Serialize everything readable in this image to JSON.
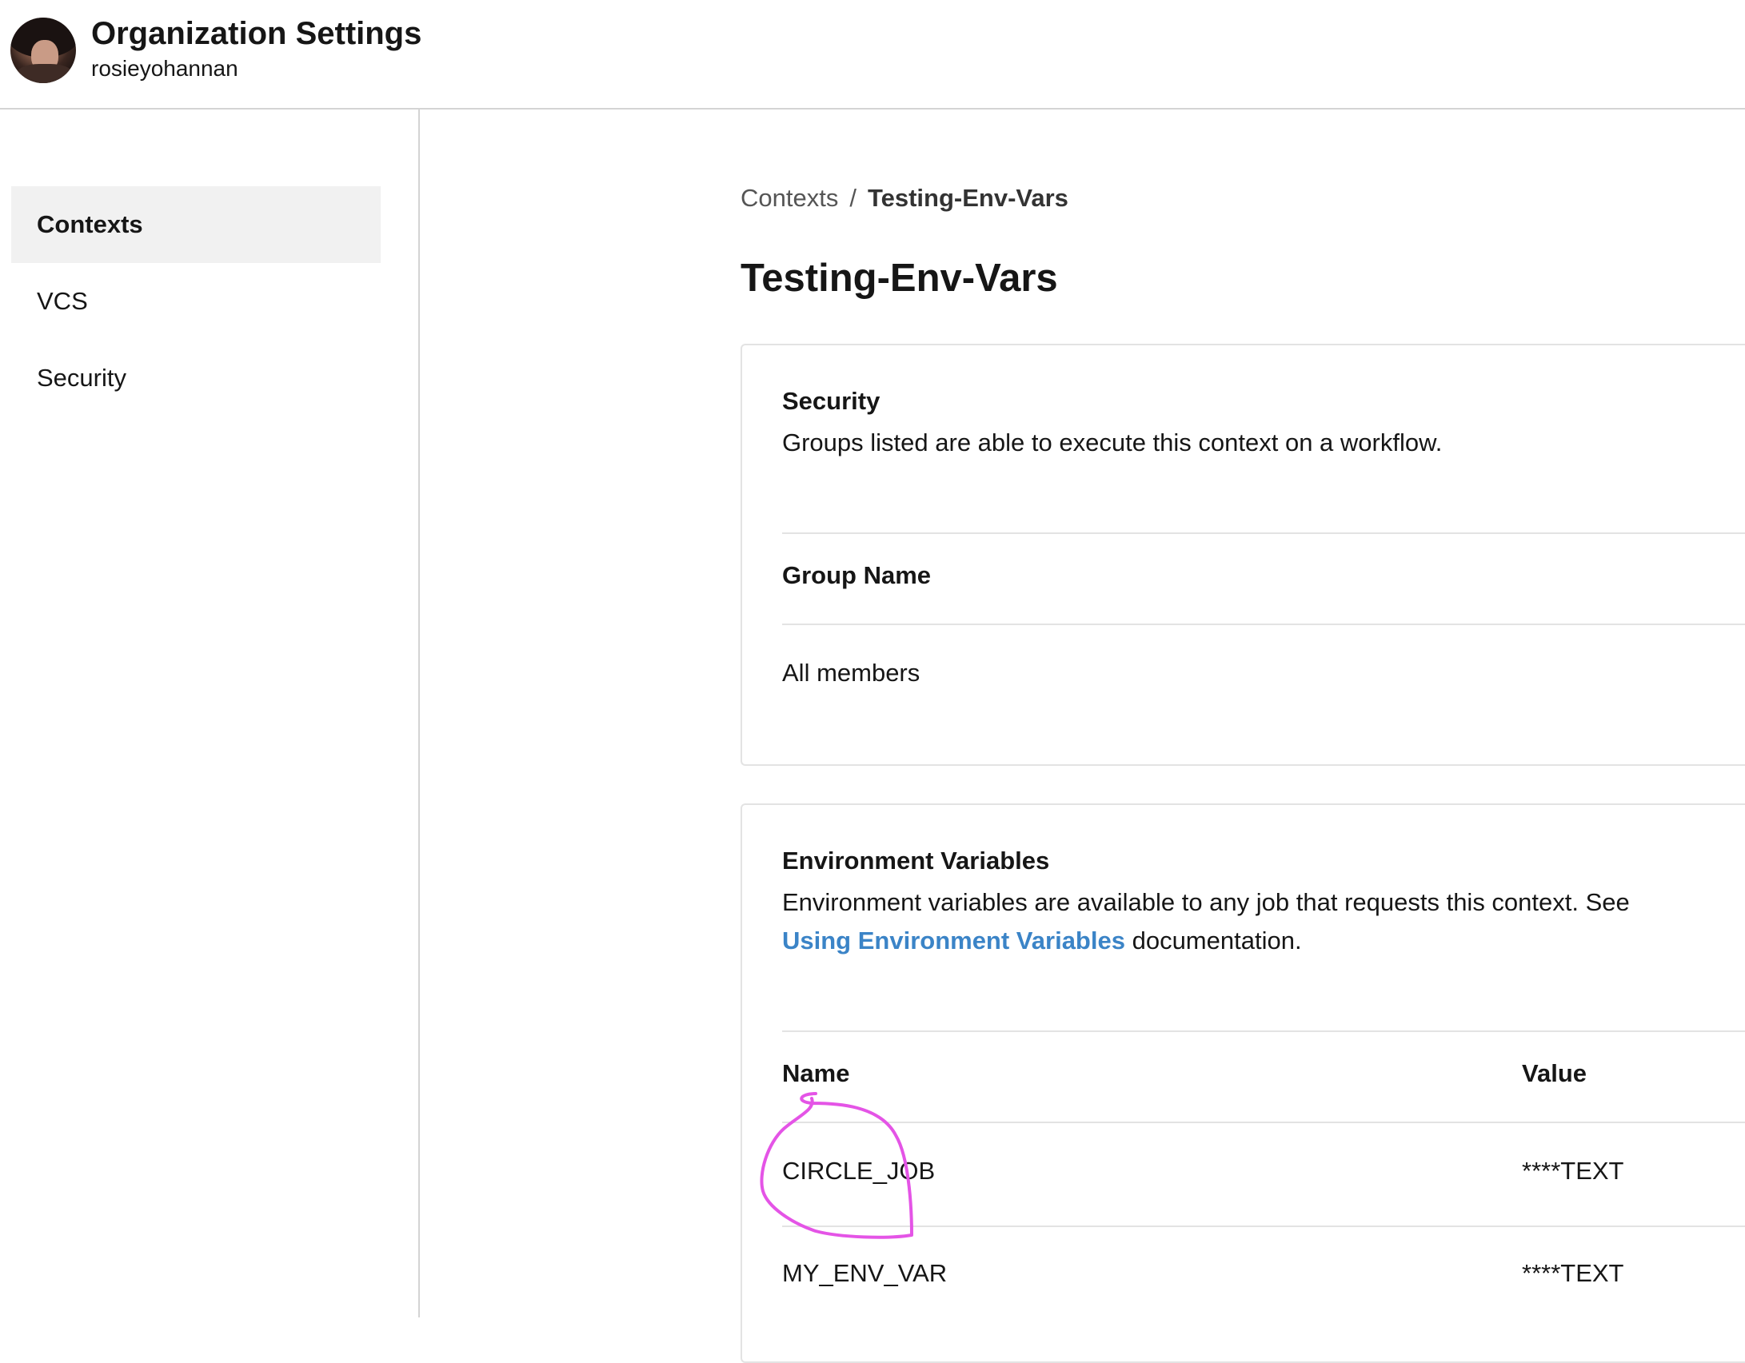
{
  "header": {
    "title": "Organization Settings",
    "username": "rosieyohannan"
  },
  "sidebar": {
    "items": [
      {
        "label": "Contexts",
        "active": true
      },
      {
        "label": "VCS",
        "active": false
      },
      {
        "label": "Security",
        "active": false
      }
    ]
  },
  "breadcrumb": {
    "parent": "Contexts",
    "separator": "/",
    "current": "Testing-Env-Vars"
  },
  "page_title": "Testing-Env-Vars",
  "security_card": {
    "heading": "Security",
    "description": "Groups listed are able to execute this context on a workflow.",
    "column_header": "Group Name",
    "groups": [
      "All members"
    ]
  },
  "env_card": {
    "heading": "Environment Variables",
    "description_before": "Environment variables are available to any job that requests this context. See ",
    "link_text": "Using Environment Variables",
    "description_after": " documentation.",
    "columns": {
      "name": "Name",
      "value": "Value"
    },
    "rows": [
      {
        "name": "CIRCLE_JOB",
        "value": "****TEXT"
      },
      {
        "name": "MY_ENV_VAR",
        "value": "****TEXT"
      }
    ]
  },
  "colors": {
    "link": "#3b84c7",
    "annotation": "#e454e6",
    "sidebar_active_bg": "#f1f1f1"
  }
}
